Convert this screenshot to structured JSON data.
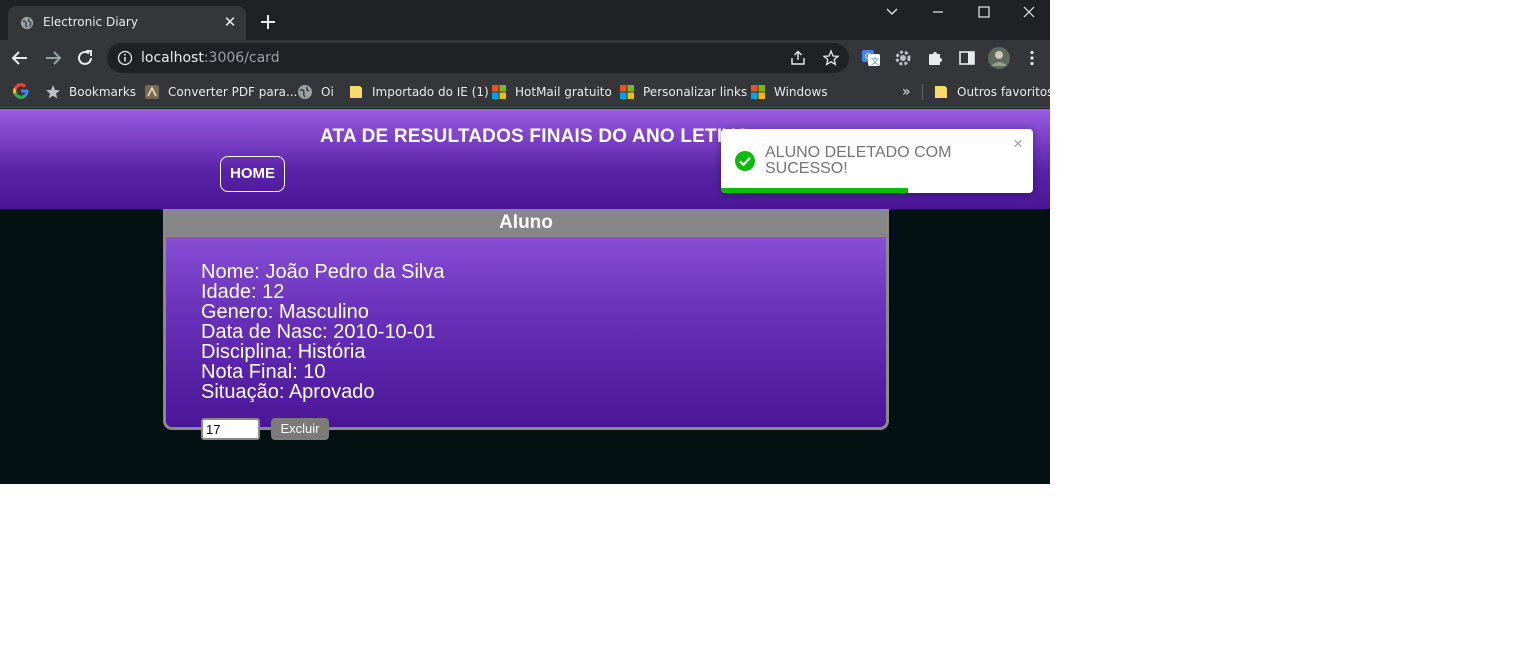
{
  "browser": {
    "tab": {
      "title": "Electronic Diary",
      "favicon": "globe-icon"
    },
    "url": {
      "host": "localhost",
      "path": ":3006/card"
    },
    "bookmarks": [
      {
        "label": "Bookmarks",
        "icon": "star-icon"
      },
      {
        "label": "Converter PDF para...",
        "icon": "pdf-converter-icon"
      },
      {
        "label": "Oi",
        "icon": "globe-icon"
      },
      {
        "label": "Importado do IE (1)",
        "icon": "folder-icon"
      },
      {
        "label": "HotMail gratuito",
        "icon": "windows-logo-icon"
      },
      {
        "label": "Personalizar links",
        "icon": "windows-logo-icon"
      },
      {
        "label": "Windows",
        "icon": "windows-logo-icon"
      }
    ],
    "bookmarks_more": "»",
    "other_bookmarks": "Outros favoritos"
  },
  "header": {
    "title": "ATA DE RESULTADOS FINAIS DO ANO LETIVO",
    "home_label": "HOME"
  },
  "card": {
    "heading": "Aluno",
    "fields": [
      "Nome: João Pedro da Silva",
      "Idade: 12",
      "Genero: Masculino",
      "Data de Nasc: 2010-10-01",
      "Disciplina: História",
      "Nota Final: 10",
      "Situação: Aprovado"
    ],
    "id_value": "17",
    "delete_label": "Excluir"
  },
  "toast": {
    "message": "ALUNO DELETADO COM SUCESSO!",
    "close": "×",
    "progress": 0.6,
    "color": "#07bc0c"
  },
  "colors": {
    "header_top": "#9b5de5",
    "header_bottom": "#4a1597",
    "page_bg": "#031112",
    "card_head": "#878787"
  }
}
